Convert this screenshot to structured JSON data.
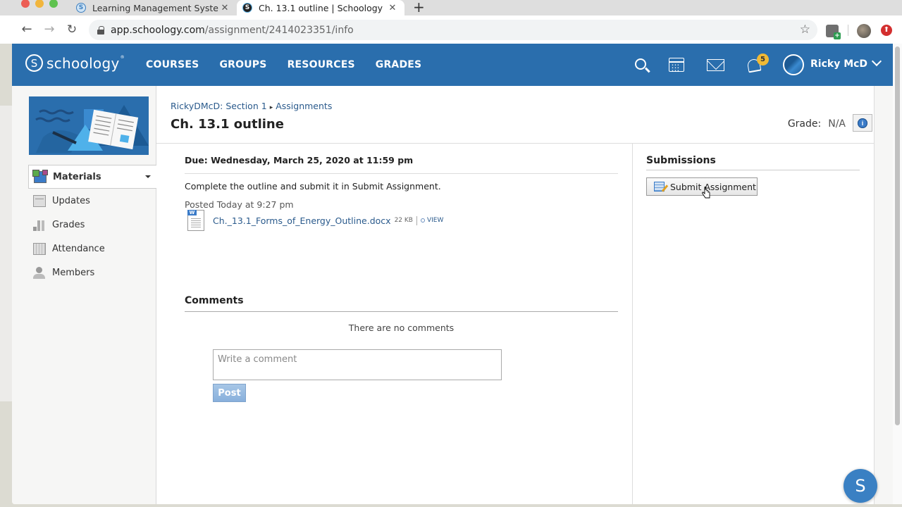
{
  "browser": {
    "tabs": [
      {
        "title": "Learning Management System",
        "favicon": "schoology-favicon",
        "active": false
      },
      {
        "title": "Ch. 13.1 outline | Schoology",
        "favicon": "schoology-favicon",
        "active": true
      }
    ],
    "tab_close_glyph": "✕",
    "new_tab_glyph": "+",
    "url_host": "app.schoology.com",
    "url_path": "/assignment/2414023351/info",
    "back_glyph": "←",
    "forward_glyph": "→",
    "reload_glyph": "↻",
    "star_glyph": "☆",
    "update_glyph": "⬆"
  },
  "header": {
    "logo_mark": "S",
    "logo_text": "schoology",
    "logo_tm": "®",
    "nav": [
      "COURSES",
      "GROUPS",
      "RESOURCES",
      "GRADES"
    ],
    "notification_count": "5",
    "user_name": "Ricky McD",
    "brand_color": "#2a6ead"
  },
  "sidebar": {
    "items": [
      {
        "label": "Materials",
        "icon": "materials-icon",
        "active": true
      },
      {
        "label": "Updates",
        "icon": "updates-icon",
        "active": false
      },
      {
        "label": "Grades",
        "icon": "grades-icon",
        "active": false
      },
      {
        "label": "Attendance",
        "icon": "attendance-icon",
        "active": false
      },
      {
        "label": "Members",
        "icon": "members-icon",
        "active": false
      }
    ]
  },
  "main": {
    "breadcrumb": {
      "course": "RickyDMcD: Section 1",
      "separator": "▸",
      "section": "Assignments"
    },
    "title": "Ch. 13.1 outline",
    "grade_label": "Grade:",
    "grade_value": "N/A",
    "info_glyph": "i",
    "due": "Due: Wednesday, March 25, 2020 at 11:59 pm",
    "description": "Complete the outline and submit it in Submit Assignment.",
    "posted": "Posted Today at 9:27 pm",
    "attachment": {
      "filename": "Ch._13.1_Forms_of_Energy_Outline.docx",
      "size": "22 KB",
      "view_label": "VIEW"
    },
    "comments": {
      "heading": "Comments",
      "empty_text": "There are no comments",
      "placeholder": "Write a comment",
      "post_label": "Post"
    }
  },
  "submissions": {
    "heading": "Submissions",
    "submit_label": "Submit Assignment"
  },
  "help_fab_label": "S"
}
